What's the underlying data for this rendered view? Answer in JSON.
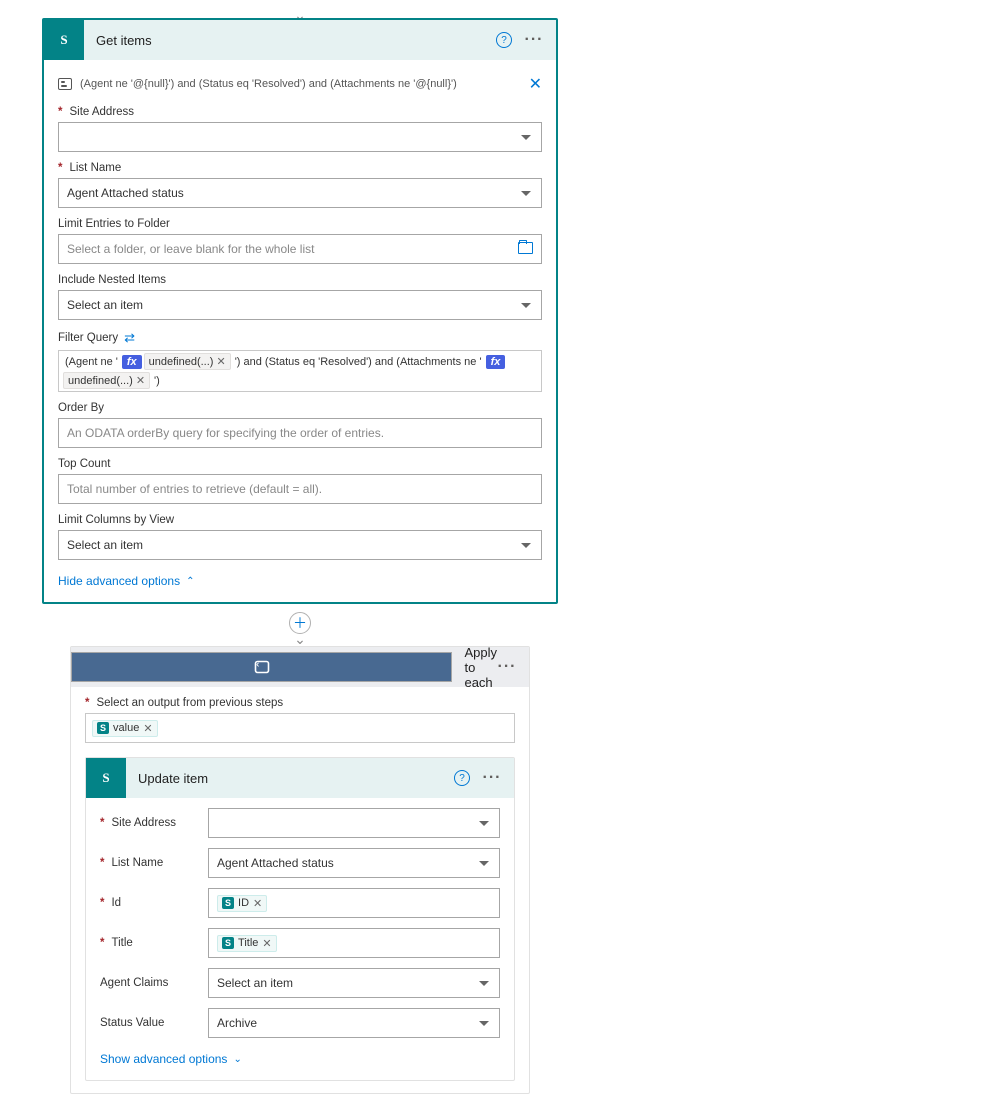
{
  "connectors": {
    "arrow": "⌄"
  },
  "getItems": {
    "title": "Get items",
    "peek": "(Agent ne '@{null}') and (Status eq 'Resolved') and (Attachments ne '@{null}')",
    "fields": {
      "siteAddress": {
        "label": "Site Address",
        "value": ""
      },
      "listName": {
        "label": "List Name",
        "value": "Agent Attached status"
      },
      "limitFolder": {
        "label": "Limit Entries to Folder",
        "placeholder": "Select a folder, or leave blank for the whole list"
      },
      "includeNested": {
        "label": "Include Nested Items",
        "value": "Select an item"
      },
      "filterQuery": {
        "label": "Filter Query",
        "parts": {
          "p1": "(Agent ne '",
          "fx": "fx",
          "undef": "undefined(...)",
          "p2": "') and (Status eq 'Resolved') and (Attachments ne '",
          "p3": "')"
        }
      },
      "orderBy": {
        "label": "Order By",
        "placeholder": "An ODATA orderBy query for specifying the order of entries."
      },
      "topCount": {
        "label": "Top Count",
        "placeholder": "Total number of entries to retrieve (default = all)."
      },
      "limitCols": {
        "label": "Limit Columns by View",
        "value": "Select an item"
      }
    },
    "advToggle": "Hide advanced options"
  },
  "applyEach": {
    "title": "Apply to each",
    "outputLabel": "Select an output from previous steps",
    "outputToken": "value",
    "advToggle": "Show advanced options"
  },
  "updateItem": {
    "title": "Update item",
    "fields": {
      "siteAddress": {
        "label": "Site Address",
        "value": ""
      },
      "listName": {
        "label": "List Name",
        "value": "Agent Attached status"
      },
      "id": {
        "label": "Id",
        "token": "ID"
      },
      "title": {
        "label": "Title",
        "token": "Title"
      },
      "agentClaims": {
        "label": "Agent Claims",
        "value": "Select an item"
      },
      "statusValue": {
        "label": "Status Value",
        "value": "Archive"
      }
    }
  },
  "icons": {
    "spBadge": "S"
  }
}
